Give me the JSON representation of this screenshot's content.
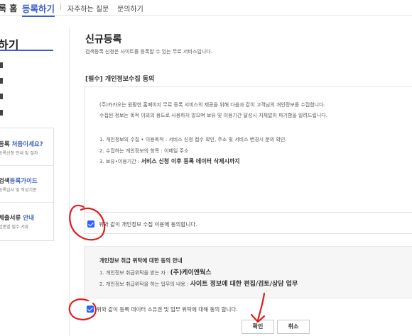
{
  "topnav": {
    "home": "록 홈",
    "register": "등록하기",
    "faq": "자주하는 질문",
    "inquiry": "문의하기"
  },
  "sidebar": {
    "title": "하기",
    "box": [
      {
        "title_blue": "처음이세요?",
        "title_pre": "등록 ",
        "sub": "등록신청 안내 및 절차"
      },
      {
        "title_pre": "검색",
        "title_blue": "등록가이드",
        "sub": "등록심사 및 작성기준"
      },
      {
        "title_pre": "제출서류 ",
        "title_blue": "안내",
        "sub": "업종별 필수 서류"
      }
    ]
  },
  "main": {
    "title": "신규등록",
    "description": "검색등록 신청은 사이트를 등록할 수 있는 무료 서비스입니다.",
    "section_title": "[필수] 개인정보수집 동의",
    "privacy": {
      "intro1": "(주)카카오는 원활한 홈페이지 무료 등록 서비스의 제공을 위해 다음과 같이 고객님의 개인정보를 수집합니다.",
      "intro2": "수집된 정보는 목적 이외의 용도로 사용하지 않으며 보유 및 이용기간 달성시 지체없이 파기함을 알려드립니다.",
      "item1": "1. 개인정보의 수집 • 이용목적 : 서비스 신청 접수 확인,  주소 및 서비스 변경시 문의 확인.",
      "item2": "2. 수집하는 개인정보의 항목 : 이메일 주소",
      "item3_pre": "3. 보유•이용기간 : ",
      "item3_big": "서비스 신청 이후 등록 데이터 삭제시까지"
    },
    "agree1": "위와 같이 개인정보 수집 이용에 동의합니다.",
    "consign": {
      "heading": "개인정보 취급 위탁에 대한 동의 안내",
      "line1_pre": "1. 개인정보 취급위탁을 받는 자 : ",
      "line1_big": "(주)케이앤웍스",
      "line2_pre": "2. 개인정보 취급위탁을 하는 업무의 내용 : ",
      "line2_big": "사이트 정보에 대한 편집/검토/상담 업무"
    },
    "agree2": "위와 같이 등록 데이터 소유권 및 업무 위탁에 대해 동의 합니다.",
    "confirm": "확인",
    "cancel": "취소"
  },
  "colors": {
    "accent": "#3b5fc4",
    "checkbox": "#2962ff",
    "annotation": "#e11d1d"
  }
}
